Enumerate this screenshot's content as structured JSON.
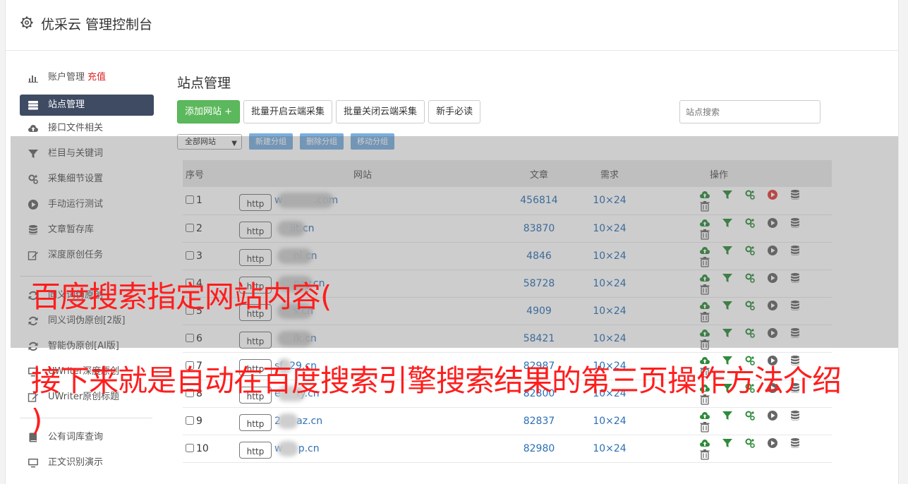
{
  "app": {
    "title": "优采云 管理控制台"
  },
  "sidebar": {
    "items": [
      {
        "label": "账户管理",
        "extra": "充值",
        "icon": "bar-chart-icon"
      },
      {
        "label": "站点管理",
        "icon": "server-icon",
        "active": true
      },
      {
        "label": "接口文件相关",
        "icon": "cloud-upload-icon"
      },
      {
        "label": "栏目与关键词",
        "icon": "filter-icon"
      },
      {
        "label": "采集细节设置",
        "icon": "gears-icon"
      },
      {
        "label": "手动运行测试",
        "icon": "play-circle-icon"
      },
      {
        "label": "文章暂存库",
        "icon": "database-icon"
      },
      {
        "label": "深度原创任务",
        "icon": "edit-icon"
      },
      {
        "label": "同义词伪原创",
        "icon": "refresh-icon"
      },
      {
        "label": "同义词伪原创[2版]",
        "icon": "refresh-icon"
      },
      {
        "label": "智能伪原创[AI版]",
        "icon": "refresh-icon"
      },
      {
        "label": "UWriter深度原创",
        "icon": "monitor-icon"
      },
      {
        "label": "UWriter原创标题",
        "icon": "edit-icon"
      },
      {
        "label": "公有词库查询",
        "icon": "book-icon"
      },
      {
        "label": "正文识别演示",
        "icon": "monitor-icon"
      }
    ]
  },
  "main": {
    "title": "站点管理",
    "buttons": {
      "add": "添加网站 +",
      "batch_open": "批量开启云端采集",
      "batch_close": "批量关闭云端采集",
      "guide": "新手必读"
    },
    "search_placeholder": "站点搜索",
    "group_select": "全部网站",
    "group_buttons": {
      "new": "新建分组",
      "delete": "删除分组",
      "move": "移动分组"
    },
    "table": {
      "headers": {
        "no": "序号",
        "site": "网站",
        "articles": "文章",
        "demand": "需求",
        "ops": "操作"
      },
      "rows": [
        {
          "no": "1",
          "proto": "http",
          "domain": "w          .com",
          "articles": "456814",
          "demand": "10×24",
          "active": true
        },
        {
          "no": "2",
          "proto": "http",
          "domain": "     iit.cn",
          "articles": "83870",
          "demand": "10×24",
          "active": false
        },
        {
          "no": "3",
          "proto": "http",
          "domain": "      ni.cn",
          "articles": "4846",
          "demand": "10×24",
          "active": false
        },
        {
          "no": "4",
          "proto": "http",
          "domain": "      pay.cn",
          "articles": "58728",
          "demand": "10×24",
          "active": false
        },
        {
          "no": "5",
          "proto": "http",
          "domain": "      s.cn",
          "articles": "4909",
          "demand": "10×24",
          "active": false
        },
        {
          "no": "6",
          "proto": "http",
          "domain": "      ik.cn",
          "articles": "58421",
          "demand": "10×24",
          "active": false
        },
        {
          "no": "7",
          "proto": "http",
          "domain": "sf  29.cn",
          "articles": "82987",
          "demand": "10×24",
          "active": false
        },
        {
          "no": "8",
          "proto": "http",
          "domain": "e     ty.cn",
          "articles": "82800",
          "demand": "10×24",
          "active": false
        },
        {
          "no": "9",
          "proto": "http",
          "domain": "2     az.cn",
          "articles": "82837",
          "demand": "10×24",
          "active": false
        },
        {
          "no": "10",
          "proto": "http",
          "domain": "w     p.cn",
          "articles": "82980",
          "demand": "10×24",
          "active": false
        }
      ]
    }
  },
  "overlay_text": {
    "line1": "百度搜索指定网站内容(",
    "line2": "接下来就是自动在百度搜索引擎搜索结果的第三页操作方法介绍",
    "line3": ")"
  },
  "colors": {
    "accent": "#3f4b63",
    "green": "#5cb85c",
    "red_text": "#ff1d1d",
    "link": "#2c6fb5"
  }
}
